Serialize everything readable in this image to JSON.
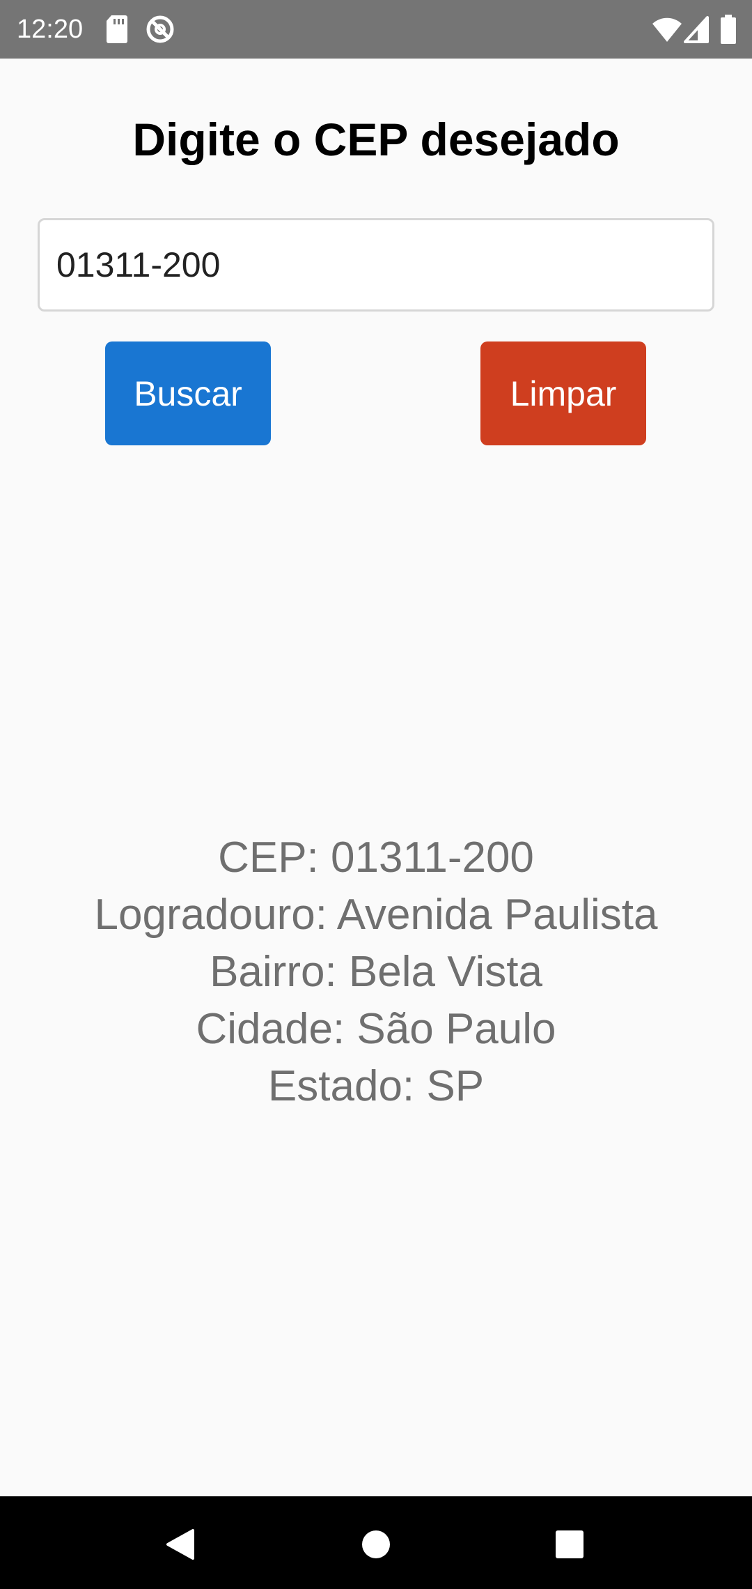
{
  "status_bar": {
    "time": "12:20",
    "left_icons": [
      "sd-card-icon",
      "no-sync-icon"
    ],
    "right_icons": [
      "wifi-icon",
      "signal-icon",
      "battery-icon"
    ],
    "background": "#757575"
  },
  "form": {
    "title": "Digite o CEP desejado",
    "cep_value": "01311-200",
    "search_label": "Buscar",
    "clear_label": "Limpar",
    "search_color": "#1976d2",
    "clear_color": "#cf3e1f"
  },
  "result": {
    "cep": "CEP: 01311-200",
    "logradouro": "Logradouro: Avenida Paulista",
    "bairro": "Bairro: Bela Vista",
    "cidade": "Cidade: São Paulo",
    "estado": "Estado: SP"
  },
  "nav_bar": {
    "icons": [
      "back-icon",
      "home-icon",
      "recents-icon"
    ]
  }
}
